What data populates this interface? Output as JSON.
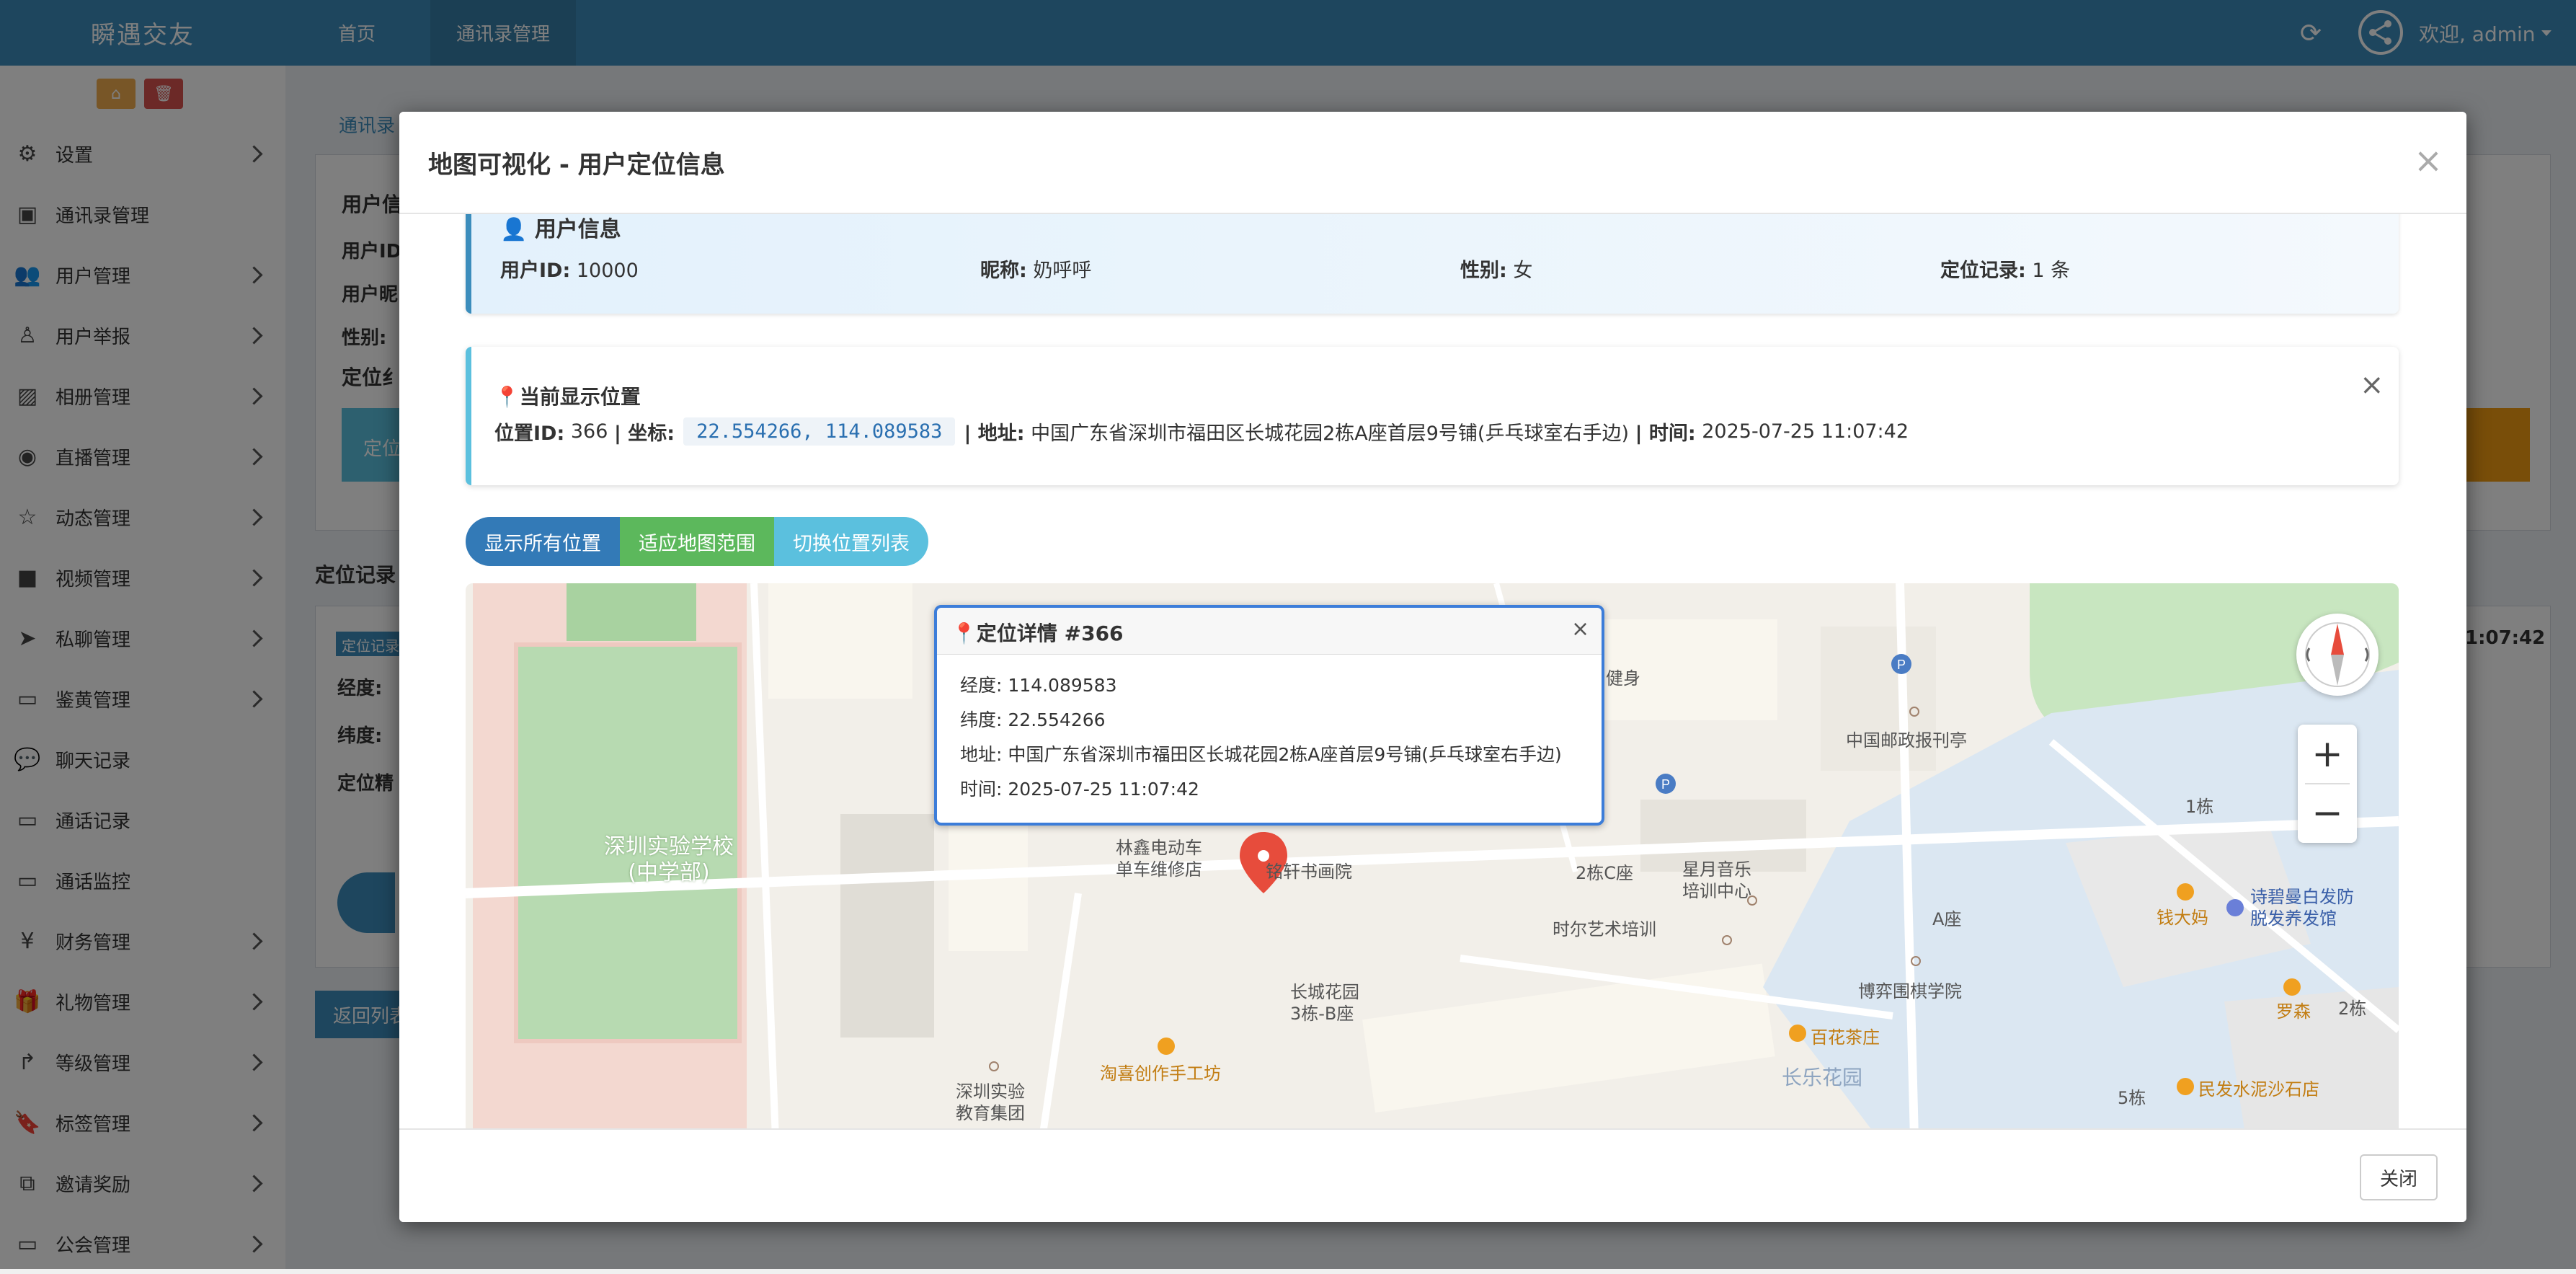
{
  "topbar": {
    "brand": "瞬遇交友",
    "nav": [
      {
        "label": "首页"
      },
      {
        "label": "通讯录管理"
      }
    ],
    "welcome": "欢迎, admin",
    "colors": {
      "bar": "#3c8dbc",
      "active": "#367fa9"
    }
  },
  "sidebar": {
    "tools": [
      {
        "icon": "home-icon"
      },
      {
        "icon": "trash-icon"
      }
    ],
    "items": [
      {
        "label": "设置",
        "icon": "gears-icon",
        "expandable": true
      },
      {
        "label": "通讯录管理",
        "icon": "address-book-icon",
        "expandable": false
      },
      {
        "label": "用户管理",
        "icon": "users-icon",
        "expandable": true
      },
      {
        "label": "用户举报",
        "icon": "user-report-icon",
        "expandable": true
      },
      {
        "label": "相册管理",
        "icon": "image-icon",
        "expandable": true
      },
      {
        "label": "直播管理",
        "icon": "eye-icon",
        "expandable": true
      },
      {
        "label": "动态管理",
        "icon": "star-icon",
        "expandable": true
      },
      {
        "label": "视频管理",
        "icon": "video-icon",
        "expandable": true
      },
      {
        "label": "私聊管理",
        "icon": "telegram-icon",
        "expandable": true
      },
      {
        "label": "鉴黄管理",
        "icon": "desktop-icon",
        "expandable": true
      },
      {
        "label": "聊天记录",
        "icon": "comments-icon",
        "expandable": false
      },
      {
        "label": "通话记录",
        "icon": "desktop-icon",
        "expandable": false
      },
      {
        "label": "通话监控",
        "icon": "desktop-icon",
        "expandable": false
      },
      {
        "label": "财务管理",
        "icon": "yen-icon",
        "expandable": true
      },
      {
        "label": "礼物管理",
        "icon": "gift-icon",
        "expandable": true
      },
      {
        "label": "等级管理",
        "icon": "level-up-icon",
        "expandable": true
      },
      {
        "label": "标签管理",
        "icon": "bookmark-icon",
        "expandable": true
      },
      {
        "label": "邀请奖励",
        "icon": "sitemap-icon",
        "expandable": true
      },
      {
        "label": "公会管理",
        "icon": "desktop-icon",
        "expandable": true
      }
    ]
  },
  "background": {
    "breadcrumb": "通讯录",
    "user_title": "用户信",
    "uid_label": "用户ID",
    "nick_label": "用户昵",
    "gender_label": "性别:",
    "locate_title": "定位纟",
    "locate_btn": "定位",
    "records_title": "定位记录",
    "record_badge": "定位记录",
    "lng_label": "经度:",
    "lat_label": "纬度:",
    "precision_label": "定位精",
    "back_btn": "返回列表",
    "time_tail": "1:07:42"
  },
  "modal": {
    "title": "地图可视化 - 用户定位信息",
    "close_label": "关闭",
    "user_info": {
      "heading": "用户信息",
      "uid_label": "用户ID:",
      "uid": "10000",
      "nick_label": "昵称:",
      "nick": "奶呼呼",
      "gender_label": "性别:",
      "gender": "女",
      "records_label": "定位记录:",
      "records": "1 条"
    },
    "current": {
      "heading": "当前显示位置",
      "id_label": "位置ID:",
      "id": "366",
      "coord_label": "| 坐标:",
      "coord": "22.554266, 114.089583",
      "addr_label": "| 地址:",
      "address": "中国广东省深圳市福田区长城花园2栋A座首层9号铺(乒乓球室右手边)",
      "time_label": "| 时间:",
      "time": "2025-07-25 11:07:42"
    },
    "buttons": {
      "show_all": "显示所有位置",
      "fit": "适应地图范围",
      "toggle": "切换位置列表"
    },
    "popup": {
      "title": "定位详情 #366",
      "lng_label": "经度:",
      "lng": "114.089583",
      "lat_label": "纬度:",
      "lat": "22.554266",
      "addr_label": "地址:",
      "address": "中国广东省深圳市福田区长城花园2栋A座首层9号铺(乒乓球室右手边)",
      "time_label": "时间:",
      "time": "2025-07-25 11:07:42"
    },
    "map_labels": {
      "school": "深圳实验学校",
      "school_sub": "(中学部)",
      "ev_repair": "林鑫电动车",
      "ev_repair2": "单车维修店",
      "gallery": "铭轩书画院",
      "bldg2c": "2栋C座",
      "music": "星月音乐",
      "music2": "培训中心",
      "art": "时尔艺术培训",
      "gym": "健身",
      "post": "中国邮政报刊亭",
      "b1": "1栋",
      "salon": "诗碧曼白发防",
      "salon2": "脱发养发馆",
      "qian": "钱大妈",
      "aseat": "A座",
      "chess": "博弈围棋学院",
      "luosen": "罗森",
      "b2": "2栋",
      "tea": "百花茶庄",
      "changle": "长乐花园",
      "b5": "5栋",
      "sand": "民发水泥沙石店",
      "gw": "长城花园",
      "gw2": "3栋-B座",
      "taoxi": "淘喜创作手工坊",
      "edu": "深圳实验",
      "edu2": "教育集团"
    }
  }
}
